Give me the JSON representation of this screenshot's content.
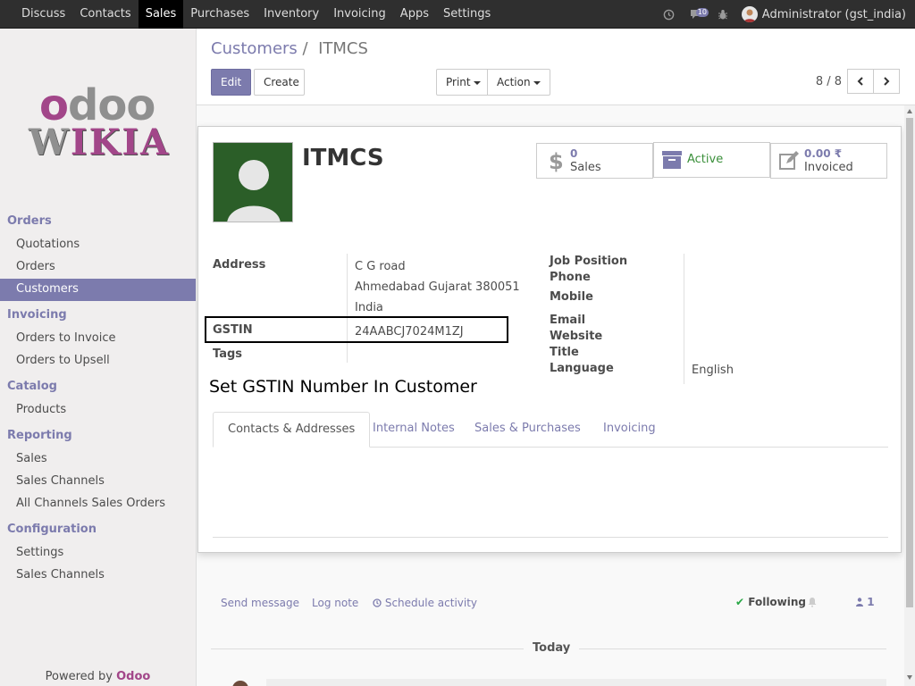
{
  "navbar": {
    "menus": [
      "Discuss",
      "Contacts",
      "Sales",
      "Purchases",
      "Inventory",
      "Invoicing",
      "Apps",
      "Settings"
    ],
    "active_menu": "Sales",
    "messages_count": "10",
    "user": "Administrator (gst_india)"
  },
  "sidebar": {
    "sections": [
      {
        "title": "Orders",
        "items": [
          "Quotations",
          "Orders",
          "Customers"
        ]
      },
      {
        "title": "Invoicing",
        "items": [
          "Orders to Invoice",
          "Orders to Upsell"
        ]
      },
      {
        "title": "Catalog",
        "items": [
          "Products"
        ]
      },
      {
        "title": "Reporting",
        "items": [
          "Sales",
          "Sales Channels",
          "All Channels Sales Orders"
        ]
      },
      {
        "title": "Configuration",
        "items": [
          "Settings",
          "Sales Channels"
        ]
      }
    ],
    "active_item": "Customers",
    "powered_prefix": "Powered by",
    "powered_brand": "Odoo"
  },
  "logo": {
    "odoo_o": "o",
    "odoo_rest": "doo",
    "wikia_w": "W",
    "wikia_rest": "IKIA"
  },
  "control_panel": {
    "breadcrumb_parent": "Customers",
    "breadcrumb_sep": "/",
    "breadcrumb_current": "ITMCS",
    "edit_label": "Edit",
    "create_label": "Create",
    "print_label": "Print",
    "action_label": "Action",
    "pager": "8 / 8"
  },
  "record": {
    "name": "ITMCS",
    "stats": {
      "sales_value": "0",
      "sales_label": "Sales",
      "active_label": "Active",
      "invoiced_value": "0.00 ₹",
      "invoiced_label": "Invoiced"
    },
    "labels": {
      "address": "Address",
      "gstin": "GSTIN",
      "tags": "Tags",
      "job_position": "Job Position",
      "phone": "Phone",
      "mobile": "Mobile",
      "email": "Email",
      "website": "Website",
      "title": "Title",
      "language": "Language"
    },
    "address_line1": "C G road",
    "address_line2": "Ahmedabad Gujarat 380051",
    "address_line3": "India",
    "gstin": "24AABCJ7024M1ZJ",
    "language": "English"
  },
  "annotation": "Set GSTIN Number In Customer",
  "tabs": [
    "Contacts & Addresses",
    "Internal Notes",
    "Sales & Purchases",
    "Invoicing"
  ],
  "active_tab": "Contacts & Addresses",
  "chatter": {
    "send_message": "Send message",
    "log_note": "Log note",
    "schedule_activity": "Schedule activity",
    "following": "Following",
    "followers_count": "1",
    "today": "Today"
  },
  "colors": {
    "brand": "#7c7bad",
    "navbar": "#2f2f2f",
    "logo_accent": "#a24689"
  }
}
